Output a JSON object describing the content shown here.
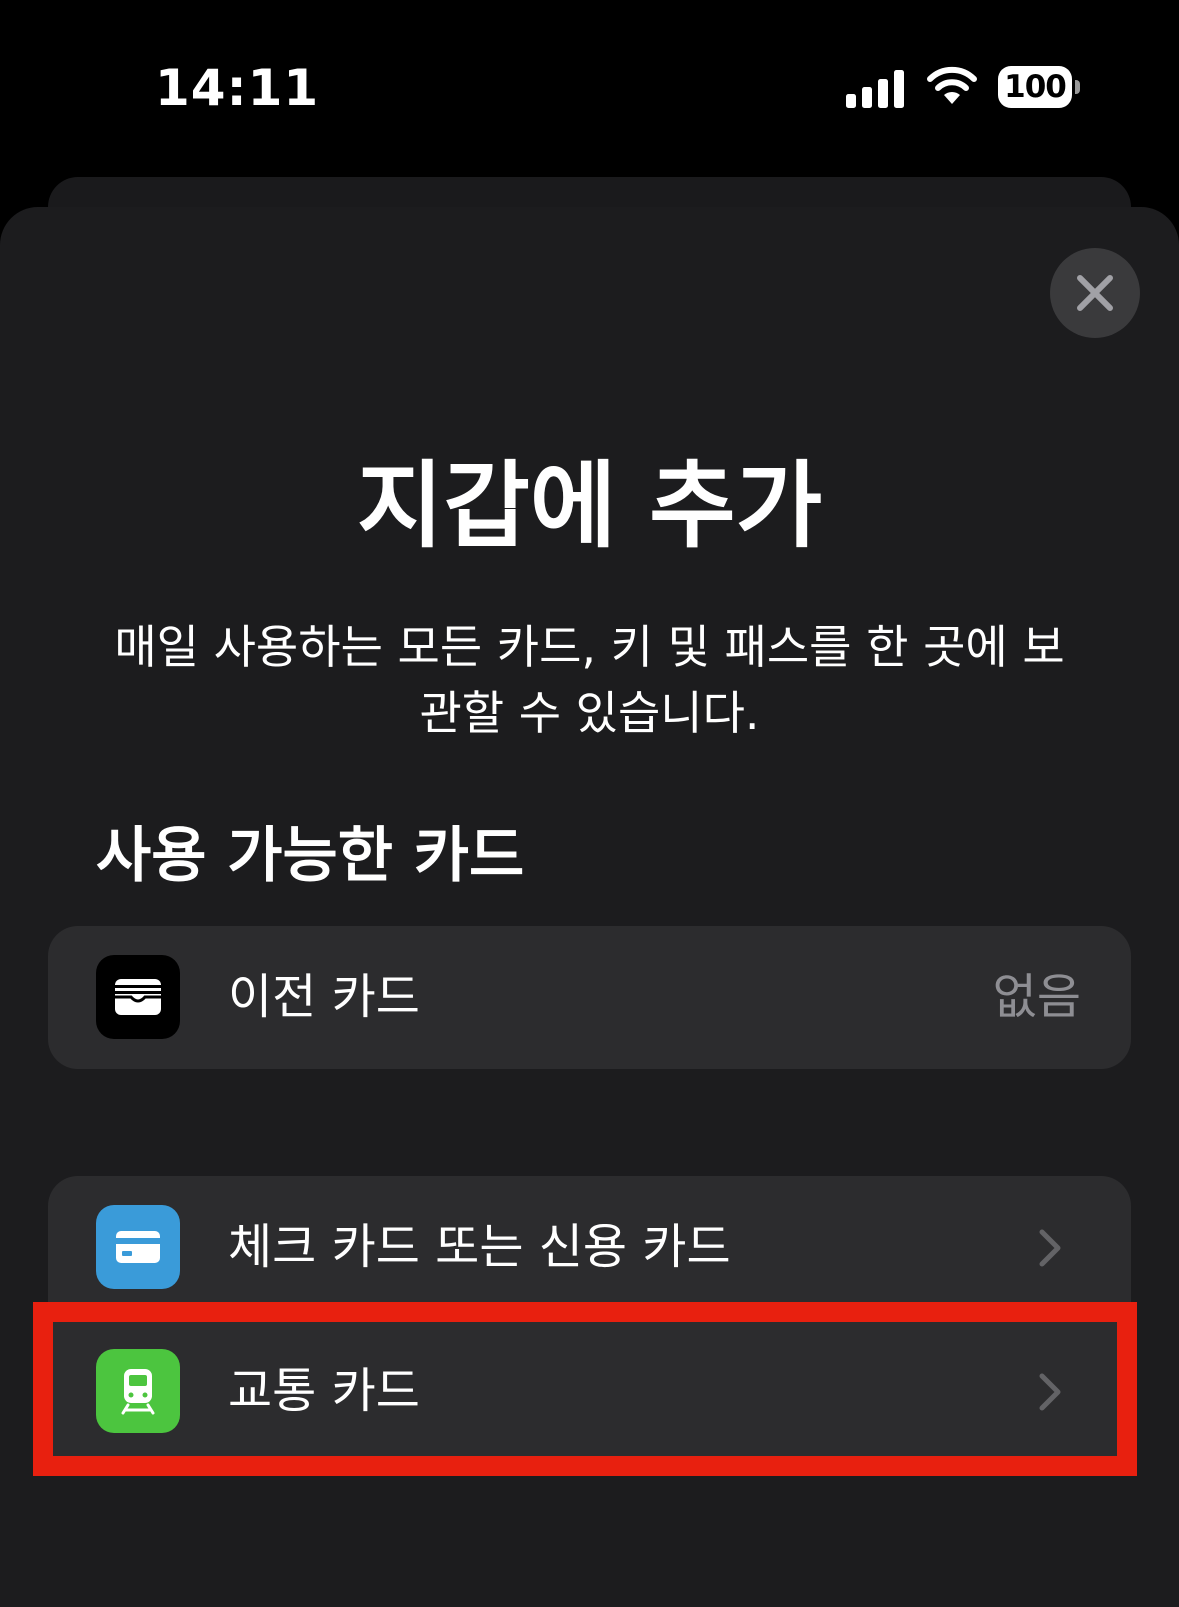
{
  "status_bar": {
    "time": "14:11",
    "battery": "100"
  },
  "sheet": {
    "title": "지갑에 추가",
    "subtitle": "매일 사용하는 모든 카드, 키 및 패스를 한 곳에 보관할 수 있습니다.",
    "section_header": "사용 가능한 카드",
    "previous_cards": {
      "label": "이전 카드",
      "value": "없음",
      "icon": "wallet-icon"
    },
    "add_options": [
      {
        "label": "체크 카드 또는 신용 카드",
        "icon": "credit-card-icon",
        "color": "#3a9bd9"
      },
      {
        "label": "교통 카드",
        "icon": "train-icon",
        "color": "#4cc53f"
      }
    ]
  },
  "colors": {
    "background": "#000000",
    "sheet": "#1c1c1e",
    "row": "#2c2c2e",
    "secondary_text": "#8e8e93",
    "highlight": "#e8200f"
  }
}
